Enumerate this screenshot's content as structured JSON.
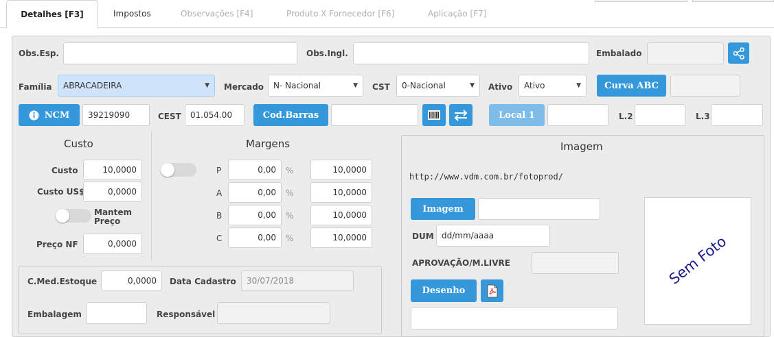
{
  "tabs": [
    {
      "label": "Detalhes [F3]"
    },
    {
      "label": "Impostos"
    },
    {
      "label": "Observações [F4]"
    },
    {
      "label": "Produto X Fornecedor [F6]"
    },
    {
      "label": "Aplicação [F7]"
    }
  ],
  "row1": {
    "obs_esp_label": "Obs.Esp.",
    "obs_esp_value": "",
    "obs_ingl_label": "Obs.Ingl.",
    "obs_ingl_value": "",
    "embalado_label": "Embalado",
    "embalado_value": ""
  },
  "row2": {
    "familia_label": "Família",
    "familia_value": "ABRACADEIRA",
    "mercado_label": "Mercado",
    "mercado_value": "N- Nacional",
    "cst_label": "CST",
    "cst_value": "0-Nacional",
    "ativo_label": "Ativo",
    "ativo_value": "Ativo",
    "curva_abc_label": "Curva ABC",
    "curva_abc_value": ""
  },
  "row3": {
    "ncm_label": "NCM",
    "ncm_value": "39219090",
    "cest_label": "CEST",
    "cest_value": "01.054.00",
    "cod_barras_label": "Cod.Barras",
    "cod_barras_value": "",
    "local1_label": "Local 1",
    "local1_value": "",
    "l2_label": "L.2",
    "l2_value": "",
    "l3_label": "L.3",
    "l3_value": ""
  },
  "custo": {
    "title": "Custo",
    "custo_label": "Custo",
    "custo_value": "10,0000",
    "custo_us_label": "Custo US$",
    "custo_us_value": "0,0000",
    "mantem_preco_line1": "Mantem",
    "mantem_preco_line2": "Preço",
    "preco_nf_label": "Preço NF",
    "preco_nf_value": "0,0000"
  },
  "margens": {
    "title": "Margens",
    "percent_symbol": "%",
    "rows": [
      {
        "label": "P",
        "percent": "0,00",
        "value": "10,0000"
      },
      {
        "label": "A",
        "percent": "0,00",
        "value": "10,0000"
      },
      {
        "label": "B",
        "percent": "0,00",
        "value": "10,0000"
      },
      {
        "label": "C",
        "percent": "0,00",
        "value": "10,0000"
      }
    ]
  },
  "estoque": {
    "cmed_label": "C.Med.Estoque",
    "cmed_value": "0,0000",
    "data_cadastro_label": "Data Cadastro",
    "data_cadastro_value": "30/07/2018",
    "embalagem_label": "Embalagem",
    "embalagem_value": "",
    "responsavel_label": "Responsável",
    "responsavel_value": ""
  },
  "imagem": {
    "title": "Imagem",
    "url": "http://www.vdm.com.br/fotoprod/",
    "imagem_button": "Imagem",
    "imagem_value": "",
    "dum_label": "DUM",
    "dum_value": "dd/mm/aaaa",
    "aprovacao_label": "APROVAÇÃO/M.LIVRE",
    "aprovacao_value": "",
    "desenho_button": "Desenho",
    "desenho_value": "",
    "sem_foto": "Sem Foto"
  },
  "colors": {
    "accent": "#3498db",
    "accent_light": "#7fbde8",
    "familia_bg": "#cfe3fb",
    "sem_foto_text": "#1a1a8c"
  }
}
